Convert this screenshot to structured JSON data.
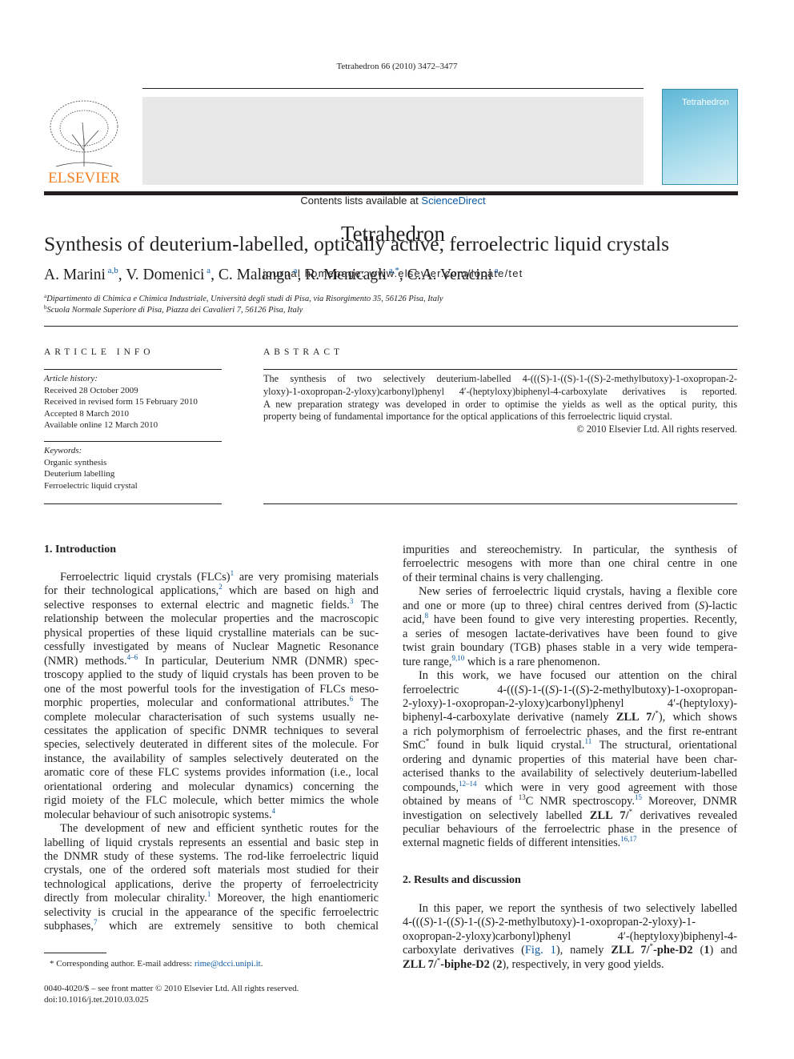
{
  "header": {
    "journal_ref": "Tetrahedron 66 (2010) 3472–3477",
    "contents_prefix": "Contents lists available at ",
    "contents_link": "ScienceDirect",
    "journal_title": "Tetrahedron",
    "homepage": "journal homepage: www.elsevier.com/locate/tet",
    "publisher_logo": "ELSEVIER",
    "cover_title": "Tetrahedron",
    "link_color": "#0b5aa6"
  },
  "article": {
    "title": "Synthesis of deuterium-labelled, optically active, ferroelectric liquid crystals",
    "authors": [
      {
        "name": "A. Marini",
        "aff": "a,b",
        "sep": ", "
      },
      {
        "name": "V. Domenici",
        "aff": "a",
        "sep": ", "
      },
      {
        "name": "C. Malanga",
        "aff": "a",
        "sep": ", "
      },
      {
        "name": "R. Menicagli",
        "aff": "a,*",
        "sep": ", "
      },
      {
        "name": "C.A. Veracini",
        "aff": "a",
        "sep": ""
      }
    ],
    "affiliations": [
      {
        "key": "a",
        "text": "Dipartimento di Chimica e Chimica Industriale, Università degli studi di Pisa, via Risorgimento 35, 56126 Pisa, Italy"
      },
      {
        "key": "b",
        "text": "Scuola Normale Superiore di Pisa, Piazza dei Cavalieri 7, 56126 Pisa, Italy"
      }
    ]
  },
  "article_info": {
    "heading": "ARTICLE INFO",
    "history_label": "Article history:",
    "history": [
      "Received 28 October 2009",
      "Received in revised form 15 February 2010",
      "Accepted 8 March 2010",
      "Available online 12 March 2010"
    ],
    "keywords_label": "Keywords:",
    "keywords": [
      "Organic synthesis",
      "Deuterium labelling",
      "Ferroelectric liquid crystal"
    ]
  },
  "abstract": {
    "heading": "ABSTRACT",
    "lines": [
      "The synthesis of two selectively deuterium-labelled 4-(((S)-1-((S)-1-((S)-2-methylbutoxy)-1-oxopropan-2-",
      "yloxy)-1-oxopropan-2-yloxy)carbonyl)phenyl 4′-(heptyloxy)biphenyl-4-carboxylate derivatives is reported.",
      "A new preparation strategy was developed in order to optimise the yields as well as the optical purity, this",
      "property being of fundamental importance for the optical applications of this ferroelectric liquid crystal.",
      "© 2010 Elsevier Ltd. All rights reserved."
    ]
  },
  "sections": {
    "intro_heading": "1.  Introduction",
    "results_heading": "2.  Results and discussion"
  },
  "left_column": [
    [
      "Ferroelectric liquid crystals (FLCs)",
      {
        "s": "1"
      },
      " are very promising materials"
    ],
    [
      "for their technological applications,",
      {
        "s": "2"
      },
      " which are based on high and"
    ],
    [
      "selective responses to external electric and magnetic fields.",
      {
        "s": "3"
      },
      " The"
    ],
    [
      "relationship between the molecular properties and the macroscopic"
    ],
    [
      "physical properties of these liquid crystalline materials can be suc-"
    ],
    [
      "cessfully investigated by means of Nuclear Magnetic Resonance"
    ],
    [
      "(NMR) methods.",
      {
        "s": "4–6"
      },
      " In particular, Deuterium NMR (DNMR) spec-"
    ],
    [
      "troscopy applied to the study of liquid crystals has been proven to be"
    ],
    [
      "one of the most powerful tools for the investigation of FLCs meso-"
    ],
    [
      "morphic properties, molecular and conformational attributes.",
      {
        "s": "6"
      },
      " The"
    ],
    [
      "complete molecular characterisation of such systems usually ne-"
    ],
    [
      "cessitates the application of specific DNMR techniques to several"
    ],
    [
      "species, selectively deuterated in different sites of the molecule. For"
    ],
    [
      "instance, the availability of samples selectively deuterated on the"
    ],
    [
      "aromatic core of these FLC systems provides information (i.e., local"
    ],
    [
      "orientational ordering and molecular dynamics) concerning the"
    ],
    [
      "rigid moiety of the FLC molecule, which better mimics the whole"
    ],
    [
      "molecular behaviour of such anisotropic systems.",
      {
        "s": "4"
      }
    ],
    [
      "The development of new and efficient synthetic routes for the"
    ],
    [
      "labelling of liquid crystals represents an essential and basic step in"
    ],
    [
      "the DNMR study of these systems. The rod-like ferroelectric liquid"
    ],
    [
      "crystals, one of the ordered soft materials most studied for their"
    ],
    [
      "technological applications, derive the property of ferroelectricity"
    ],
    [
      "directly from molecular chirality.",
      {
        "s": "1"
      },
      " Moreover, the high enantiomeric"
    ],
    [
      "selectivity is crucial in the appearance of the specific ferroelectric"
    ],
    [
      "subphases,",
      {
        "s": "7"
      },
      " which are extremely sensitive to both chemical"
    ]
  ],
  "right_column": [
    [
      "impurities and stereochemistry. In particular, the synthesis of"
    ],
    [
      "ferroelectric mesogens with more than one chiral centre in one"
    ],
    [
      "of their terminal chains is very challenging."
    ],
    [
      "New series of ferroelectric liquid crystals, having a flexible core"
    ],
    [
      "and one or more (up to three) chiral centres derived from (",
      {
        "i": "S"
      },
      ")-lactic"
    ],
    [
      "acid,",
      {
        "s": "8"
      },
      " have been found to give very interesting properties. Recently,"
    ],
    [
      "a series of mesogen lactate-derivatives have been found to give"
    ],
    [
      "twist grain boundary (TGB) phases stable in a very wide tempera-"
    ],
    [
      "ture range,",
      {
        "s": "9,10"
      },
      " which is a rare phenomenon."
    ],
    [
      "In this work, we have focused our attention on the chiral"
    ],
    [
      "ferroelectric 4-(((",
      {
        "i": "S"
      },
      ")-1-((",
      {
        "i": "S"
      },
      ")-1-((",
      {
        "i": "S"
      },
      ")-2-methylbutoxy)-1-oxopropan-"
    ],
    [
      "2-yloxy)-1-oxopropan-2-yloxy)carbonyl)phenyl 4′-(heptyloxy)-"
    ],
    [
      "biphenyl-4-carboxylate derivative (namely ",
      {
        "b": "ZLL 7/"
      },
      {
        "st": "*"
      },
      "), which shows"
    ],
    [
      "a rich polymorphism of ferroelectric phases, and the first re-entrant"
    ],
    [
      "SmC",
      {
        "st": "*"
      },
      " found in bulk liquid crystal.",
      {
        "s": "11"
      },
      " The structural, orientational"
    ],
    [
      "ordering and dynamic properties of this material have been char-"
    ],
    [
      "acterised thanks to the availability of selectively deuterium-labelled"
    ],
    [
      "compounds,",
      {
        "s": "12–14"
      },
      " which were in very good agreement with those"
    ],
    [
      "obtained by means of ",
      {
        "st": "13"
      },
      "C NMR spectroscopy.",
      {
        "s": "15"
      },
      " Moreover, DNMR"
    ],
    [
      "investigation on selectively labelled ",
      {
        "b": "ZLL 7/"
      },
      {
        "st": "*"
      },
      " derivatives revealed"
    ],
    [
      "peculiar behaviours of the ferroelectric phase in the presence of"
    ],
    [
      "external magnetic fields of different intensities.",
      {
        "s": "16,17"
      }
    ],
    [
      "In this paper, we report the synthesis of two selectively labelled"
    ],
    [
      "4-(((",
      {
        "i": "S"
      },
      ")-1-((",
      {
        "i": "S"
      },
      ")-1-((",
      {
        "i": "S"
      },
      ")-2-methylbutoxy)-1-oxopropan-2-yloxy)-1-"
    ],
    [
      "oxopropan-2-yloxy)carbonyl)phenyl 4′-(heptyloxy)biphenyl-4-"
    ],
    [
      "carboxylate derivatives (",
      {
        "l": "Fig. 1"
      },
      "), namely ",
      {
        "b": "ZLL 7/"
      },
      {
        "st": "*"
      },
      {
        "b": "-phe-D2"
      },
      " (",
      {
        "b": "1"
      },
      ") and"
    ],
    [
      {
        "b": "ZLL 7/"
      },
      {
        "st": "*"
      },
      {
        "b": "-biphe-D2"
      },
      " (",
      {
        "b": "2"
      },
      "), respectively, in very good yields."
    ]
  ],
  "footnote": {
    "mark": "*",
    "text": " Corresponding author. E-mail address: ",
    "email": "rime@dcci.unipi.it",
    "end": "."
  },
  "bottom": {
    "issn": "0040-4020/$ – see front matter © 2010 Elsevier Ltd. All rights reserved.",
    "doi": "doi:10.1016/j.tet.2010.03.025"
  }
}
